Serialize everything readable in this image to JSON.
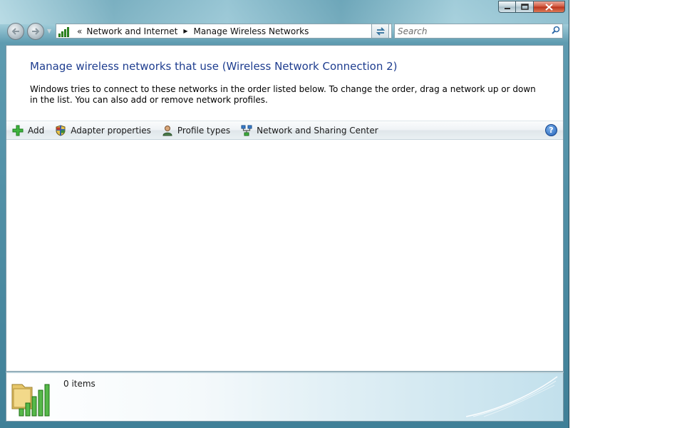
{
  "window": {
    "caption_buttons": [
      "minimize-icon",
      "maximize-icon",
      "close-icon"
    ]
  },
  "navigation": {
    "back_icon": "back-arrow-icon",
    "forward_icon": "forward-arrow-icon",
    "address": {
      "icon": "network-signal-icon",
      "overflow_glyph": "«",
      "crumbs": [
        "Network and Internet",
        "Manage Wireless Networks"
      ]
    },
    "search": {
      "placeholder": "Search"
    }
  },
  "main": {
    "heading": "Manage wireless networks that use (Wireless Network Connection 2)",
    "description": "Windows tries to connect to these networks in the order listed below. To change the order, drag a network up or down in the list. You can also add or remove network profiles."
  },
  "toolbar": {
    "add_label": "Add",
    "adapter_label": "Adapter properties",
    "profile_label": "Profile types",
    "sharing_label": "Network and Sharing Center",
    "help_glyph": "?"
  },
  "details": {
    "item_count": "0 items",
    "icon": "wireless-networks-folder-icon"
  },
  "colors": {
    "heading": "#1e3d8f",
    "add_icon": "#2fa32f",
    "frame": "#4a8aa1"
  }
}
